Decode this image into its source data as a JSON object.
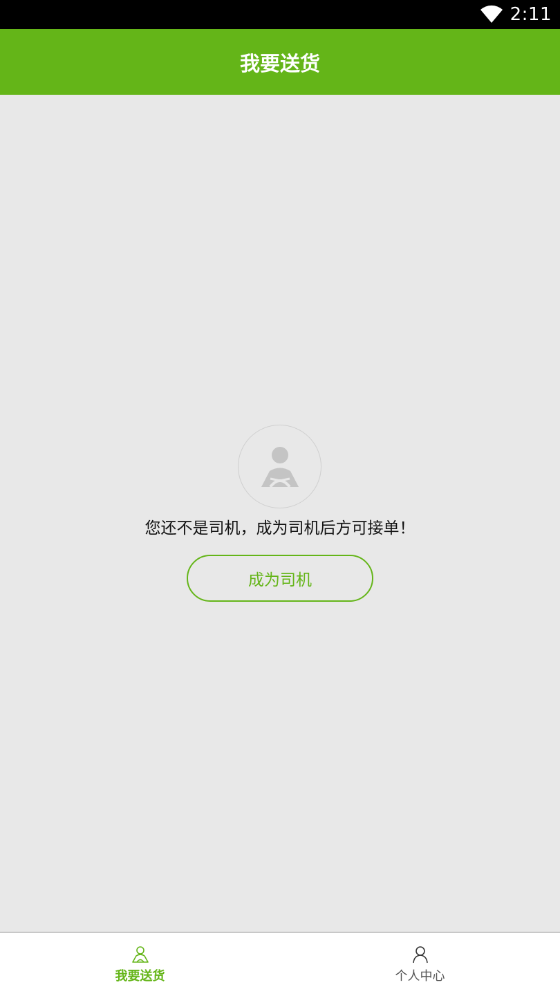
{
  "status_bar": {
    "time": "2:11",
    "wifi_icon": "wifi-icon"
  },
  "app_bar": {
    "title": "我要送货",
    "background": "#64b518"
  },
  "main": {
    "avatar_icon": "driver-icon",
    "notice": "您还不是司机，成为司机后方可接单！",
    "become_driver_label": "成为司机"
  },
  "bottom_nav": {
    "tabs": [
      {
        "label": "我要送货",
        "icon": "driver-icon",
        "active": true
      },
      {
        "label": "个人中心",
        "icon": "person-icon",
        "active": false
      }
    ]
  },
  "colors": {
    "accent": "#64b518",
    "background": "#e8e8e8",
    "status_bar": "#000000",
    "inactive_text": "#555555"
  }
}
